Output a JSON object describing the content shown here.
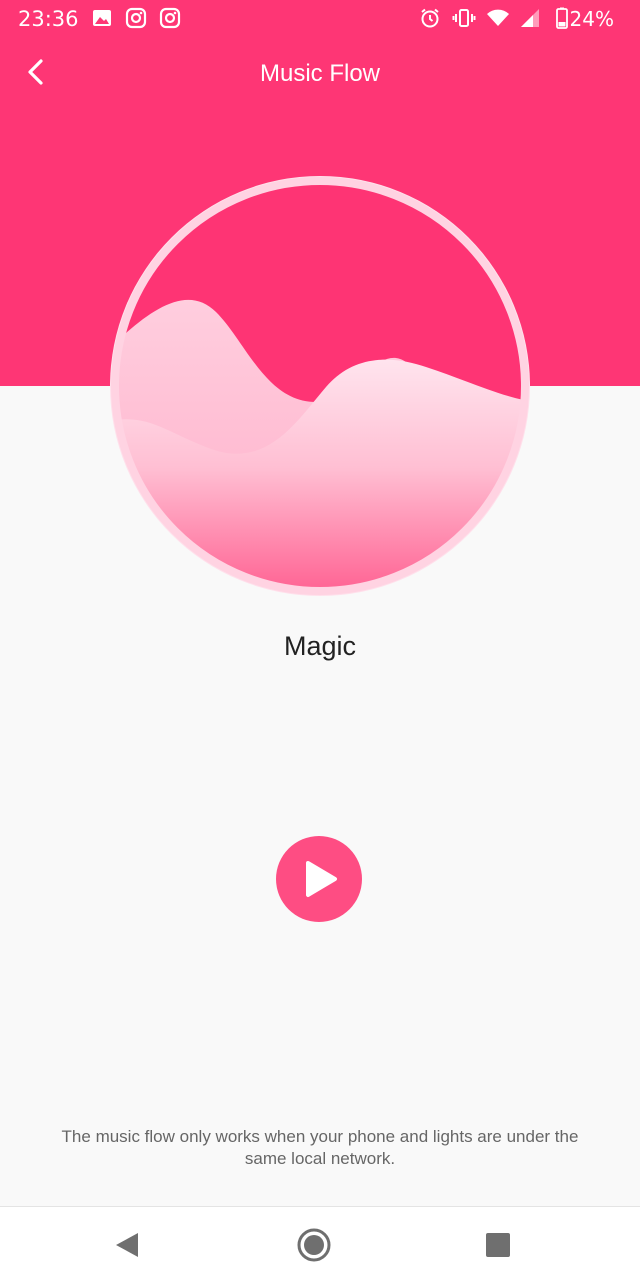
{
  "status_bar": {
    "time": "23:36",
    "battery": "24%",
    "icons": [
      "image-icon",
      "instagram-icon",
      "instagram-icon",
      "alarm-icon",
      "vibrate-icon",
      "wifi-icon",
      "signal-icon",
      "battery-icon"
    ]
  },
  "header": {
    "title": "Music Flow",
    "back_icon": "chevron-left-icon"
  },
  "mode": {
    "label": "Magic"
  },
  "player": {
    "play_icon": "play-icon"
  },
  "footer_note": "The music flow only works when your phone and lights are under the same local network.",
  "nav": {
    "back": "nav-back-icon",
    "home": "nav-home-icon",
    "recents": "nav-recents-icon"
  },
  "colors": {
    "accent": "#fe3675",
    "button": "#fe4d83",
    "background": "#f9f9f9"
  }
}
